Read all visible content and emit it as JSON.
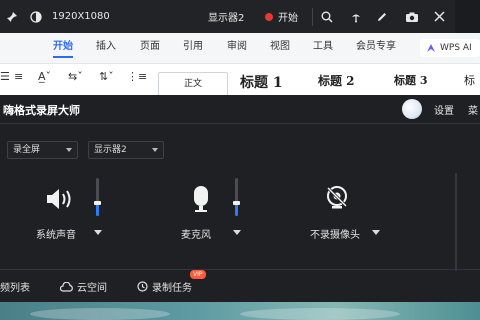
{
  "topbar": {
    "resolution": "1920X1080",
    "display": "显示器2",
    "start_label": "开始"
  },
  "ribbon": {
    "tabs": [
      "开始",
      "插入",
      "页面",
      "引用",
      "审阅",
      "视图",
      "工具",
      "会员专享"
    ],
    "ai_label": "WPS AI",
    "styles": [
      "正文",
      "标题 1",
      "标题 2",
      "标题 3",
      "标"
    ]
  },
  "app": {
    "title": "嗨格式录屏大师",
    "settings_label": "设置",
    "menu_label": "菜"
  },
  "selects": {
    "mode": "录全屏",
    "monitor": "显示器2"
  },
  "devices": {
    "speaker": {
      "label": "系统声音",
      "level": 0.35
    },
    "mic": {
      "label": "麦克风",
      "level": 0.35
    },
    "camera": {
      "label": "不录摄像头"
    }
  },
  "footer": {
    "video_list": "频列表",
    "cloud": "云空间",
    "tasks": "录制任务",
    "vip": "VIP"
  },
  "colors": {
    "accent": "#2e7cf6",
    "record_red": "#e53935",
    "ribbon_active": "#2f6bf0"
  }
}
